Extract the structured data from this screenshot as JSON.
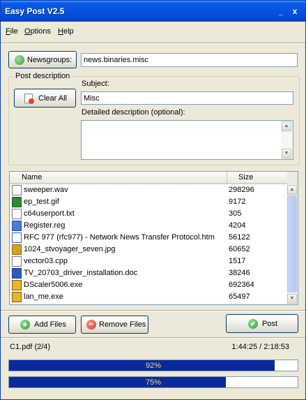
{
  "window": {
    "title": "Easy Post V2.5",
    "minimize": "_",
    "close": "x"
  },
  "menu": [
    {
      "u": "F",
      "rest": "ile"
    },
    {
      "u": "O",
      "rest": "ptions"
    },
    {
      "u": "H",
      "rest": "elp"
    }
  ],
  "newsgroups": {
    "button_label": "Newsgroups:",
    "value": "news.binaries.misc"
  },
  "post_description": {
    "group_label": "Post description",
    "clear_all_label": "Clear All",
    "subject_label": "Subject:",
    "subject_value": "Misc",
    "detail_label": "Detailed description (optional):",
    "detail_value": ""
  },
  "file_list": {
    "columns": [
      "Name",
      "Size"
    ],
    "rows": [
      {
        "name": "sweeper.wav",
        "size": "298296",
        "icon": "wav-file-icon"
      },
      {
        "name": "ep_test.gif",
        "size": "9172",
        "icon": "gif-file-icon"
      },
      {
        "name": "c64userport.txt",
        "size": "305",
        "icon": "text-file-icon"
      },
      {
        "name": "Register.reg",
        "size": "4204",
        "icon": "registry-file-icon"
      },
      {
        "name": "RFC 977 (rfc977) - Network News Transfer Protocol.htm",
        "size": "56122",
        "icon": "html-file-icon"
      },
      {
        "name": "1024_stvoyager_seven.jpg",
        "size": "60652",
        "icon": "jpg-file-icon"
      },
      {
        "name": "vector03.cpp",
        "size": "1517",
        "icon": "cpp-file-icon"
      },
      {
        "name": "TV_20703_driver_installation.doc",
        "size": "38246",
        "icon": "word-doc-icon"
      },
      {
        "name": "DScaler5006.exe",
        "size": "692364",
        "icon": "exe-file-icon"
      },
      {
        "name": "lan_me.exe",
        "size": "65497",
        "icon": "exe-file-icon"
      }
    ]
  },
  "actions": {
    "add_files": "Add Files",
    "remove_files": "Remove Files",
    "post": "Post"
  },
  "status": {
    "current_file": "C1.pdf (2/4)",
    "time": "1:44:25 / 2:18:53"
  },
  "progress": [
    {
      "percent": 92,
      "label": "92%"
    },
    {
      "percent": 75,
      "label": "75%"
    }
  ],
  "colors": {
    "titlebar": "#0553e0",
    "progress_fill": "#0a2a9c",
    "add_icon": "#3aa843",
    "remove_icon": "#d93c2c"
  }
}
